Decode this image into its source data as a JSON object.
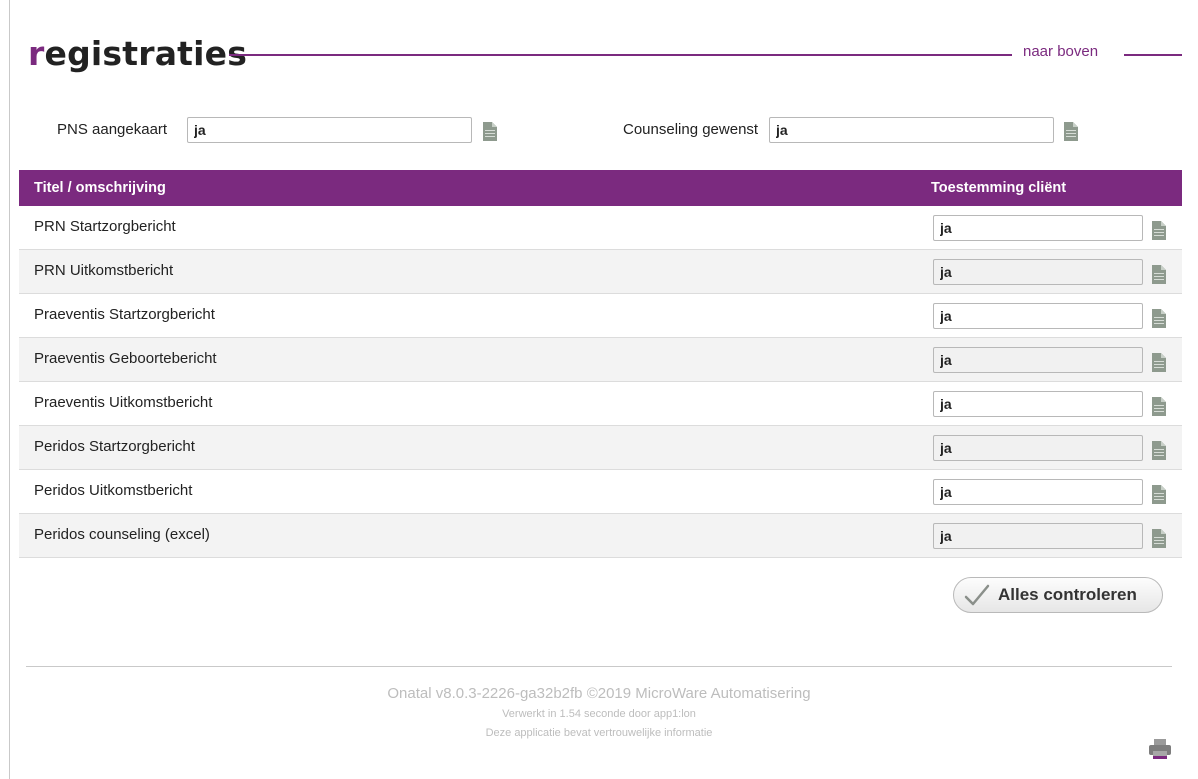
{
  "header": {
    "title_first": "r",
    "title_rest": "egistraties",
    "naar_boven": "naar boven"
  },
  "fields": {
    "pns": {
      "label": "PNS aangekaart",
      "value": "ja"
    },
    "counseling": {
      "label": "Counseling gewenst",
      "value": "ja"
    }
  },
  "table": {
    "col_title": "Titel / omschrijving",
    "col_consent": "Toestemming cliënt",
    "rows": [
      {
        "label": "PRN Startzorgbericht",
        "value": "ja"
      },
      {
        "label": "PRN Uitkomstbericht",
        "value": "ja"
      },
      {
        "label": "Praeventis Startzorgbericht",
        "value": "ja"
      },
      {
        "label": "Praeventis Geboortebericht",
        "value": "ja"
      },
      {
        "label": "Praeventis Uitkomstbericht",
        "value": "ja"
      },
      {
        "label": "Peridos Startzorgbericht",
        "value": "ja"
      },
      {
        "label": "Peridos Uitkomstbericht",
        "value": "ja"
      },
      {
        "label": "Peridos counseling (excel)",
        "value": "ja"
      }
    ]
  },
  "actions": {
    "check_all": "Alles controleren"
  },
  "footer": {
    "version": "Onatal v8.0.3-2226-ga32b2fb ©2019 MicroWare Automatisering",
    "processed": "Verwerkt in 1.54 seconde door app1:lon",
    "confidential": "Deze applicatie bevat vertrouwelijke informatie"
  },
  "colors": {
    "brand": "#7b2a7f",
    "icon": "#8e9a8e"
  },
  "icons": {
    "notes": "document-icon",
    "check": "checkmark-icon",
    "print": "printer-icon"
  }
}
